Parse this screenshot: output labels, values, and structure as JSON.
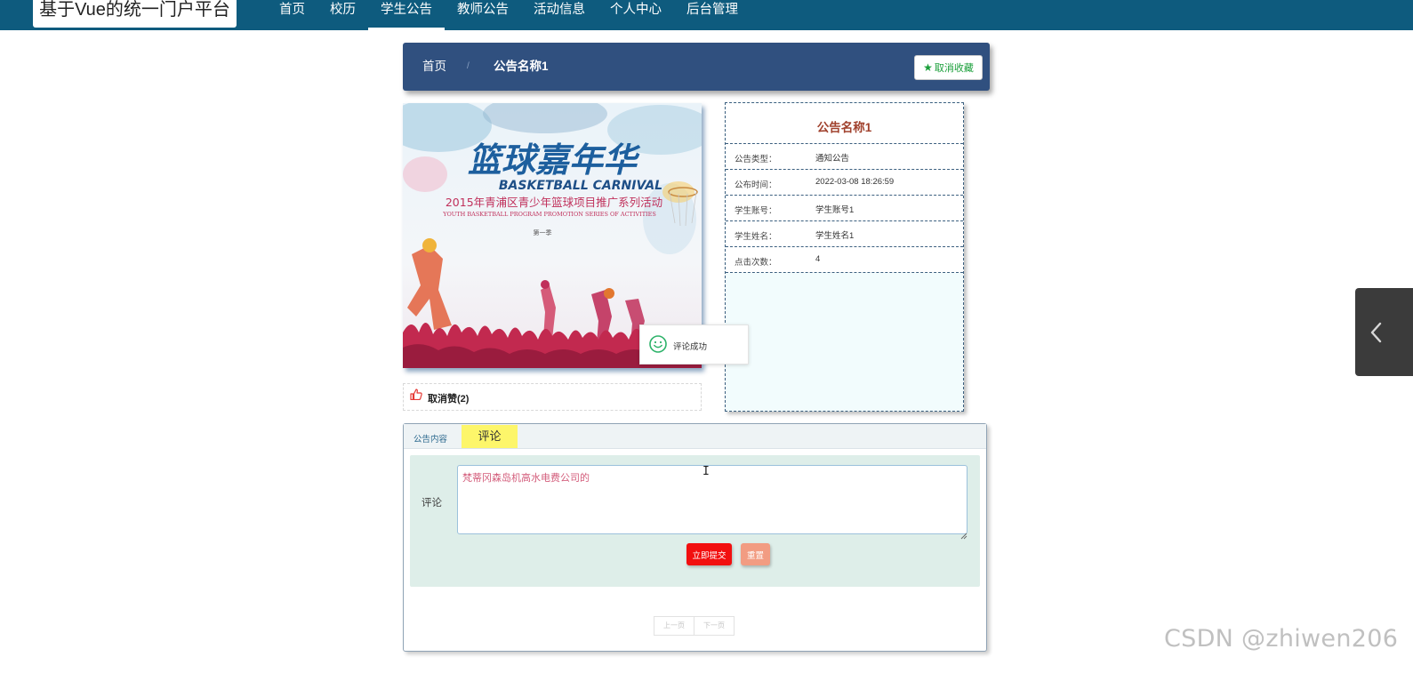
{
  "header": {
    "brand": "基于Vue的统一门户平台",
    "nav": [
      {
        "label": "首页"
      },
      {
        "label": "校历"
      },
      {
        "label": "学生公告"
      },
      {
        "label": "教师公告"
      },
      {
        "label": "活动信息"
      },
      {
        "label": "个人中心"
      },
      {
        "label": "后台管理"
      }
    ],
    "active_nav": "学生公告"
  },
  "breadcrumb": {
    "home": "首页",
    "separator": "/",
    "current": "公告名称1",
    "favorite_button": "取消收藏",
    "favorite_icon": "star-icon"
  },
  "poster": {
    "title_cn": "篮球嘉年华",
    "title_en": "BASKETBALL CARNIVAL",
    "subtitle_cn": "2015年青浦区青少年篮球项目推广系列活动",
    "subtitle_en": "YOUTH BASKETBALL PROGRAM PROMOTION SERIES OF ACTIVITIES",
    "season": "第一季"
  },
  "like": {
    "icon": "thumbs-up-icon",
    "label": "取消赞(2)"
  },
  "info": {
    "title": "公告名称1",
    "rows": [
      {
        "key": "公告类型：",
        "value": "通知公告"
      },
      {
        "key": "公布时间：",
        "value": "2022-03-08 18:26:59"
      },
      {
        "key": "学生账号：",
        "value": "学生账号1"
      },
      {
        "key": "学生姓名：",
        "value": "学生姓名1"
      },
      {
        "key": "点击次数：",
        "value": "4"
      }
    ]
  },
  "toast": {
    "icon": "smile-icon",
    "message": "评论成功"
  },
  "tabs": {
    "content": "公告内容",
    "comment": "评论",
    "active": "评论"
  },
  "comment_form": {
    "label": "评论",
    "value": "梵蒂冈森岛机高水电费公司的",
    "submit": "立即提交",
    "reset": "重置"
  },
  "pager": {
    "prev": "上一页",
    "next": "下一页"
  },
  "watermark": "CSDN @zhiwen206",
  "colors": {
    "nav_bg": "#0e5b7e",
    "crumb_bg": "#30507f",
    "info_title": "#a0412d",
    "tab_highlight": "#fdf66a",
    "submit": "#f20f0f",
    "reset": "#f29c82"
  }
}
